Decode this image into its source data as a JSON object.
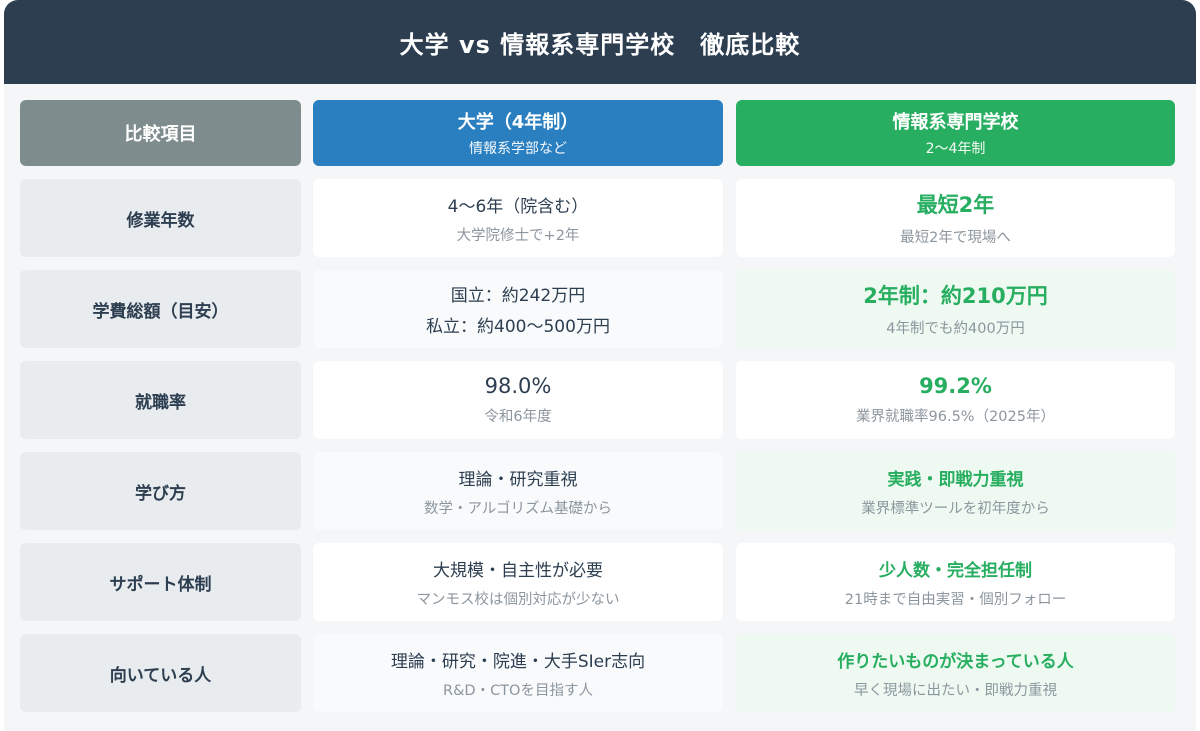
{
  "title": "大学 vs 情報系専門学校　徹底比較",
  "header": {
    "label": "比較項目",
    "university": {
      "main": "大学（4年制）",
      "sub": "情報系学部など"
    },
    "senmon": {
      "main": "情報系専門学校",
      "sub": "2〜4年制"
    }
  },
  "rows": [
    {
      "label": "修業年数",
      "uni_main": "4〜6年（院含む）",
      "uni_line2": "",
      "uni_sub": "大学院修士で+2年",
      "sen_main": "最短2年",
      "sen_sub": "最短2年で現場へ"
    },
    {
      "label": "学費総額（目安）",
      "uni_main": "国立：約242万円",
      "uni_line2": "私立：約400〜500万円",
      "uni_sub": "",
      "sen_main": "2年制：約210万円",
      "sen_sub": "4年制でも約400万円"
    },
    {
      "label": "就職率",
      "uni_main": "98.0%",
      "uni_line2": "",
      "uni_sub": "令和6年度",
      "sen_main": "99.2%",
      "sen_sub": "業界就職率96.5%（2025年）"
    },
    {
      "label": "学び方",
      "uni_main": "理論・研究重視",
      "uni_line2": "",
      "uni_sub": "数学・アルゴリズム基礎から",
      "sen_main": "実践・即戦力重視",
      "sen_sub": "業界標準ツールを初年度から"
    },
    {
      "label": "サポート体制",
      "uni_main": "大規模・自主性が必要",
      "uni_line2": "",
      "uni_sub": "マンモス校は個別対応が少ない",
      "sen_main": "少人数・完全担任制",
      "sen_sub": "21時まで自由実習・個別フォロー"
    },
    {
      "label": "向いている人",
      "uni_main": "理論・研究・院進・大手SIer志向",
      "uni_line2": "",
      "uni_sub": "R&D・CTOを目指す人",
      "sen_main": "作りたいものが決まっている人",
      "sen_sub": "早く現場に出たい・即戦力重視"
    }
  ],
  "colors": {
    "title_bg": "#2c3e50",
    "label_header_bg": "#7f8c8d",
    "university_accent": "#2a7fc0",
    "senmon_accent": "#27ae60"
  }
}
